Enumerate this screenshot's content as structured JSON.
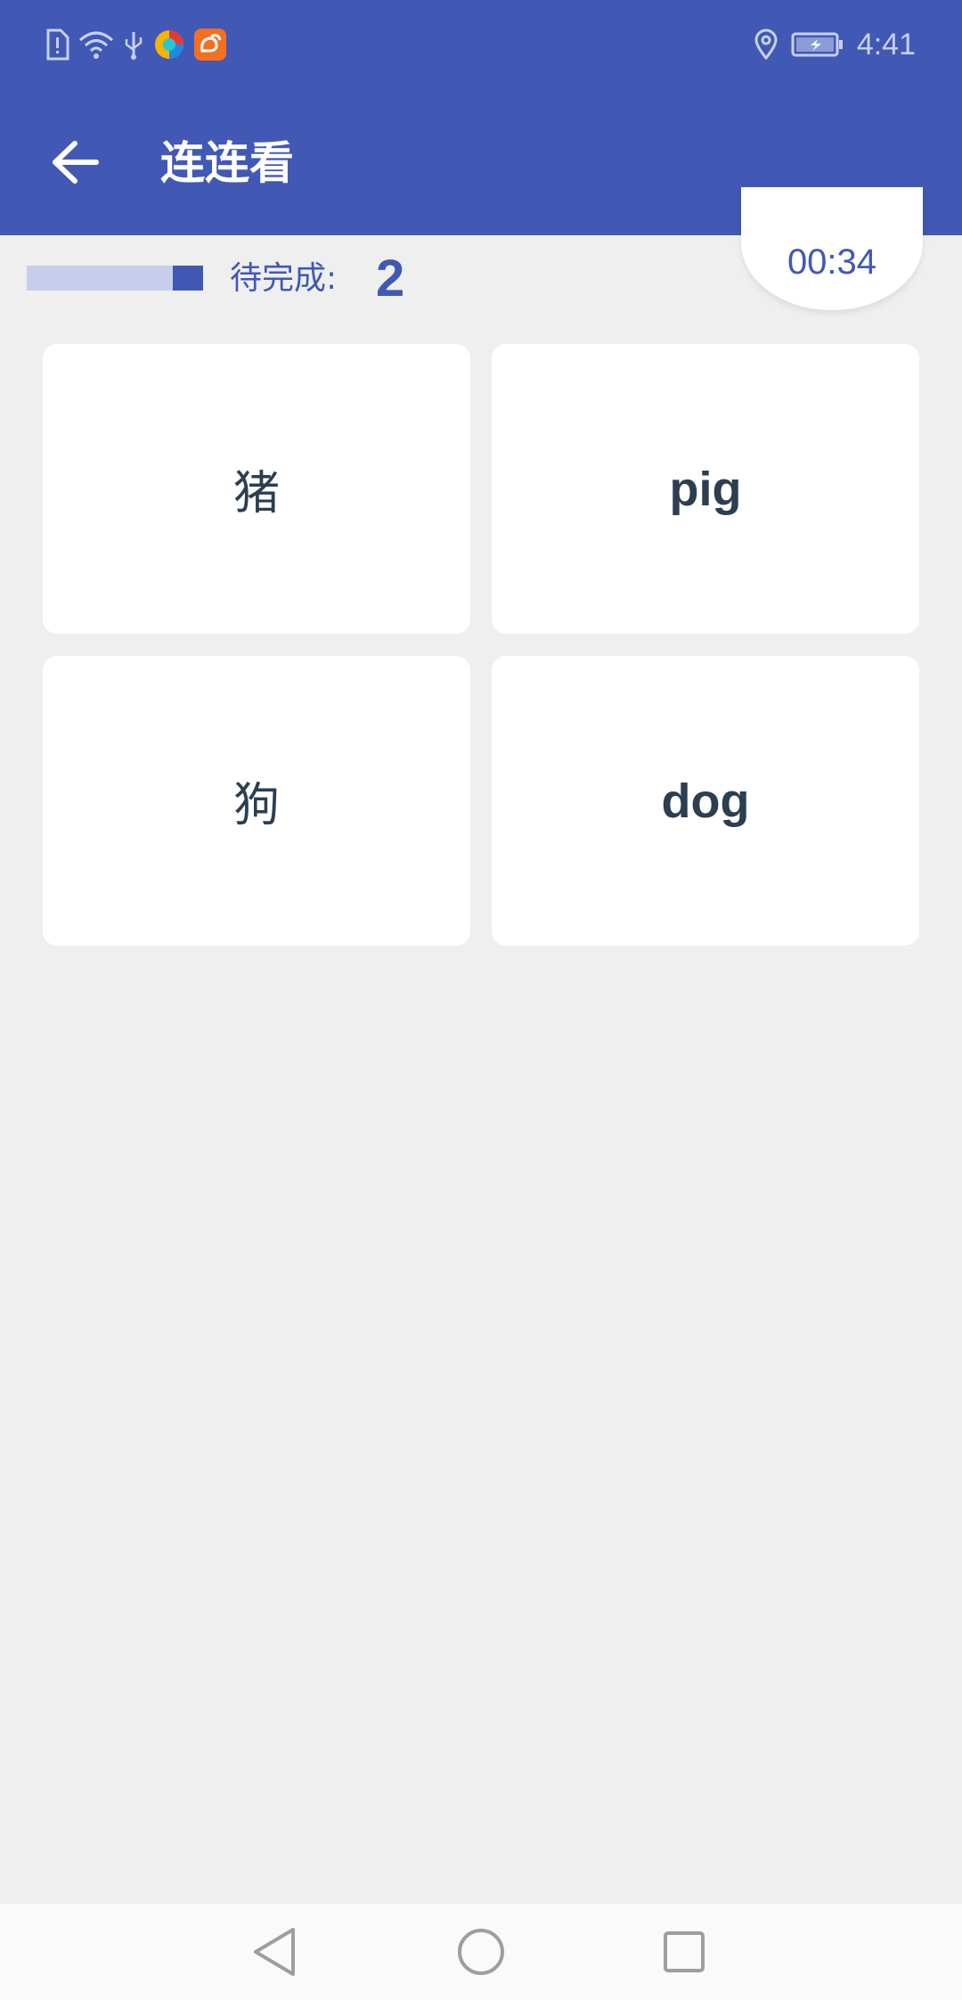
{
  "status_bar": {
    "time": "4:41",
    "icons": [
      "sim-alert-icon",
      "wifi-icon",
      "usb-icon",
      "browser-app-icon",
      "uc-browser-icon",
      "location-icon",
      "battery-charging-icon"
    ]
  },
  "toolbar": {
    "title": "连连看",
    "back_icon": "arrow-left-icon"
  },
  "progress": {
    "fraction": 0.17,
    "pending_label": "待完成:",
    "pending_count": "2"
  },
  "timer": {
    "value": "00:34"
  },
  "cards": [
    {
      "text": "猪",
      "lang": "zh"
    },
    {
      "text": "pig",
      "lang": "en"
    },
    {
      "text": "狗",
      "lang": "zh"
    },
    {
      "text": "dog",
      "lang": "en"
    }
  ],
  "nav_bar": {
    "icons": [
      "back-triangle-icon",
      "home-circle-icon",
      "recents-square-icon"
    ]
  },
  "colors": {
    "primary": "#4159b4",
    "background": "#efefef",
    "card_text": "#2c3e50",
    "progress_track": "#c8cdeb"
  }
}
